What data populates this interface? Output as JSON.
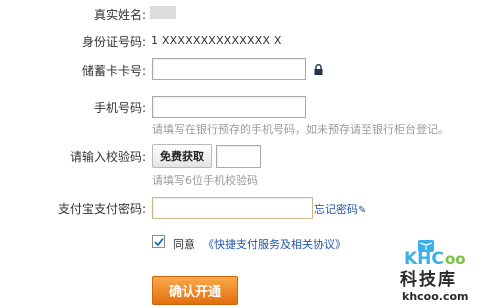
{
  "form": {
    "real_name_label": "真实姓名:",
    "id_number_label": "身份证号码:",
    "id_number_value": "1 XXXXXXXXXXXXXX X",
    "card_label": "储蓄卡卡号:",
    "card_value": "",
    "phone_label": "手机号码:",
    "phone_value": "",
    "phone_hint": "请填写在银行预存的手机号码，如未预存请至银行柜台登记。",
    "code_label": "请输入校验码:",
    "get_code_button": "免费获取",
    "code_value": "",
    "code_hint": "请填写6位手机校验码",
    "pay_password_label": "支付宝支付密码:",
    "pay_password_value": "",
    "forgot_password": "忘记密码",
    "agree_checked": true,
    "agree_label": "同意",
    "protocol_link": "《快捷支付服务及相关协议》",
    "submit_button": "确认开通"
  },
  "watermark": {
    "brand": "KHCoo",
    "cn": "科技库",
    "url": "khcoo.com"
  },
  "colors": {
    "submit_top": "#f9a94b",
    "submit_bottom": "#e36f0d",
    "link": "#2255aa",
    "hint": "#9a9a9a"
  }
}
